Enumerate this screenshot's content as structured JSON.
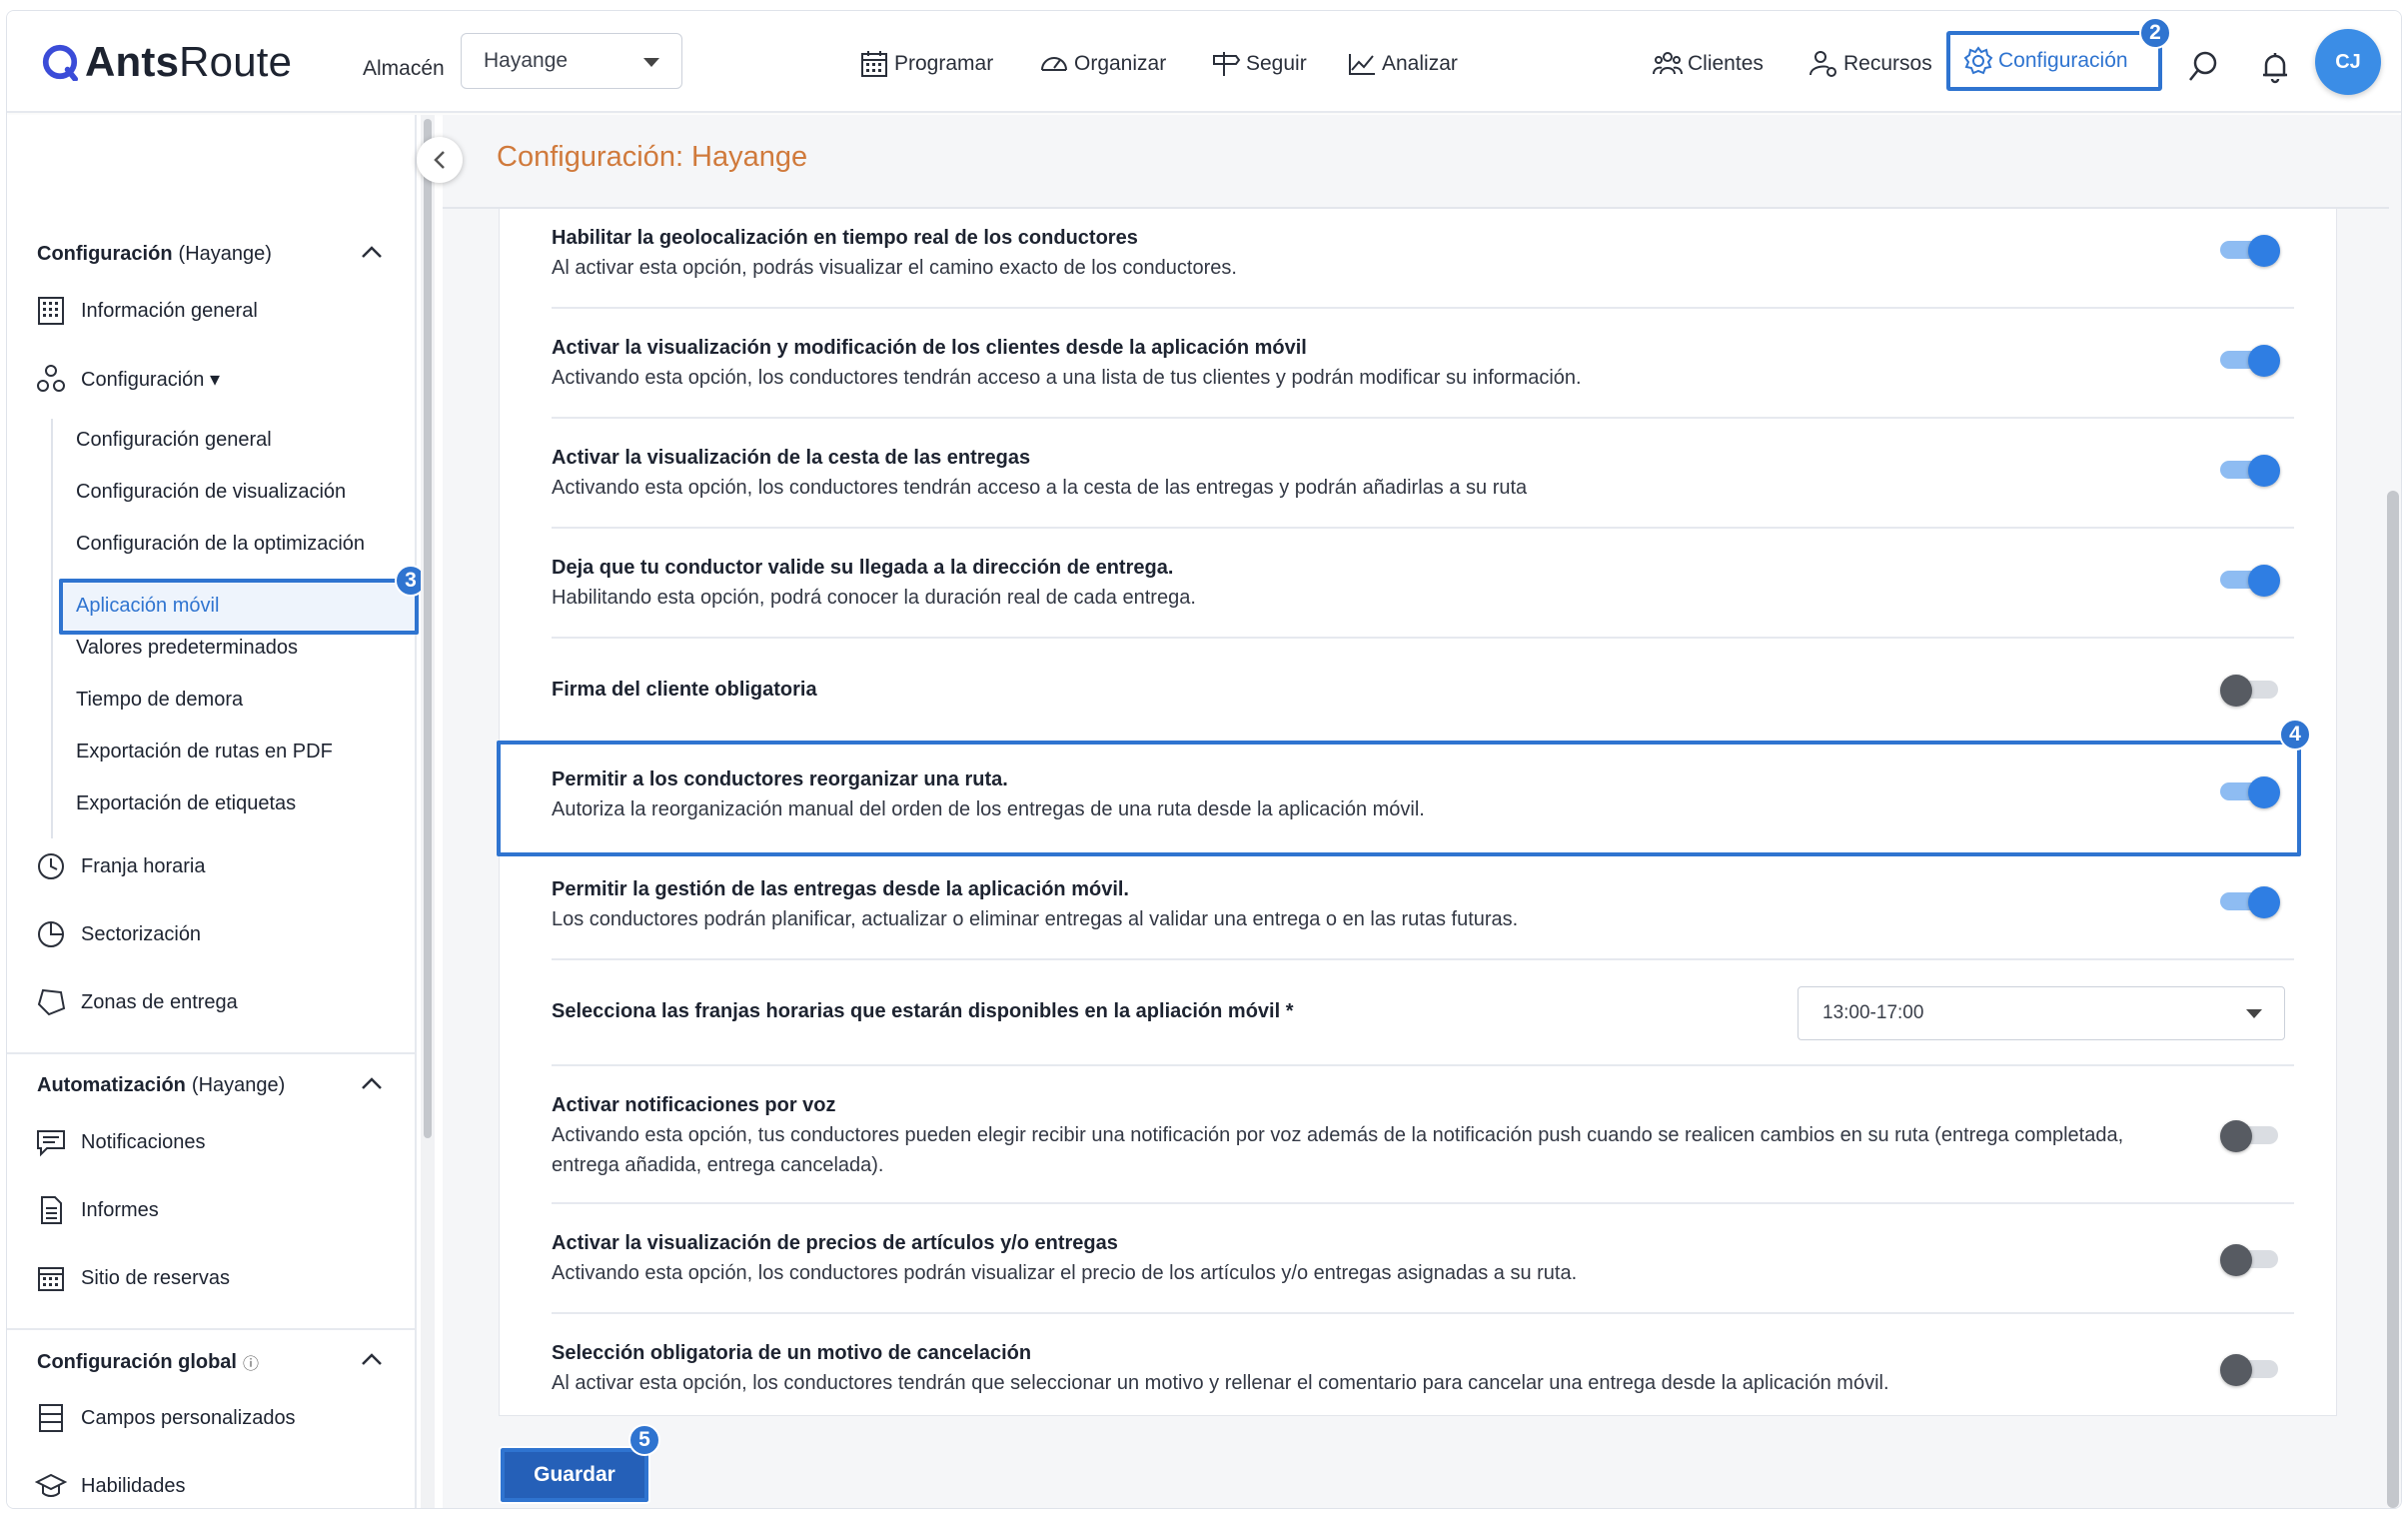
{
  "brand": {
    "name_bold": "Ants",
    "name_rest": "Route"
  },
  "warehouse": {
    "label": "Almacén",
    "selected": "Hayange"
  },
  "nav": {
    "programar": "Programar",
    "organizar": "Organizar",
    "seguir": "Seguir",
    "analizar": "Analizar",
    "clientes": "Clientes",
    "recursos": "Recursos",
    "configuracion": "Configuración"
  },
  "user": {
    "initials": "CJ"
  },
  "badges": {
    "b2": "2",
    "b3": "3",
    "b4": "4",
    "b5": "5"
  },
  "sidebar": {
    "config_section": {
      "title": "Configuración",
      "scope": "(Hayange)"
    },
    "general_info": "Información general",
    "configuracion": "Configuración ▾",
    "sub": [
      "Configuración general",
      "Configuración de visualización",
      "Configuración de la optimización",
      "Aplicación móvil",
      "Valores predeterminados",
      "Tiempo de demora",
      "Exportación de rutas en PDF",
      "Exportación de etiquetas"
    ],
    "franja": "Franja horaria",
    "sectorizacion": "Sectorización",
    "zonas": "Zonas de entrega",
    "auto_section": {
      "title": "Automatización",
      "scope": "(Hayange)"
    },
    "notificaciones": "Notificaciones",
    "informes": "Informes",
    "reservas": "Sitio de reservas",
    "global_section": {
      "title": "Configuración global",
      "info": "ⓘ"
    },
    "campos": "Campos personalizados",
    "habilidades": "Habilidades"
  },
  "page": {
    "title": "Configuración: Hayange"
  },
  "settings": [
    {
      "title": "Habilitar la geolocalización en tiempo real de los conductores",
      "desc": "Al activar esta opción, podrás visualizar el camino exacto de los conductores.",
      "on": true
    },
    {
      "title": "Activar la visualización y modificación de los clientes desde la aplicación móvil",
      "desc": "Activando esta opción, los conductores tendrán acceso a una lista de tus clientes y podrán modificar su información.",
      "on": true
    },
    {
      "title": "Activar la visualización de la cesta de las entregas",
      "desc": "Activando esta opción, los conductores tendrán acceso a la cesta de las entregas y podrán añadirlas a su ruta",
      "on": true
    },
    {
      "title": "Deja que tu conductor valide su llegada a la dirección de entrega.",
      "desc": "Habilitando esta opción, podrá conocer la duración real de cada entrega.",
      "on": true
    },
    {
      "title": "Firma del cliente obligatoria",
      "desc": "",
      "on": false
    },
    {
      "title": "Permitir a los conductores reorganizar una ruta.",
      "desc": "Autoriza la reorganización manual del orden de los entregas de una ruta desde la aplicación móvil.",
      "on": true
    },
    {
      "title": "Permitir la gestión de las entregas desde la aplicación móvil.",
      "desc": "Los conductores podrán planificar, actualizar o eliminar entregas al validar una entrega o en las rutas futuras.",
      "on": true
    },
    {
      "title": "Selecciona las franjas horarias que estarán disponibles en la apliación móvil *",
      "select": "13:00-17:00"
    },
    {
      "title": "Activar notificaciones por voz",
      "desc": "Activando esta opción, tus conductores pueden elegir recibir una notificación por voz además de la notificación push cuando se realicen cambios en su ruta (entrega completada, entrega añadida, entrega cancelada).",
      "on": false
    },
    {
      "title": "Activar la visualización de precios de artículos y/o entregas",
      "desc": "Activando esta opción, los conductores podrán visualizar el precio de los artículos y/o entregas asignadas a su ruta.",
      "on": false
    },
    {
      "title": "Selección obligatoria de un motivo de cancelación",
      "desc": "Al activar esta opción, los conductores tendrán que seleccionar un motivo y rellenar el comentario para cancelar una entrega desde la aplicación móvil.",
      "on": false
    }
  ],
  "save_label": "Guardar",
  "colors": {
    "accent": "#2f74d0",
    "title_orange": "#d07a3c",
    "toggle_on": "#2f7ee3"
  }
}
